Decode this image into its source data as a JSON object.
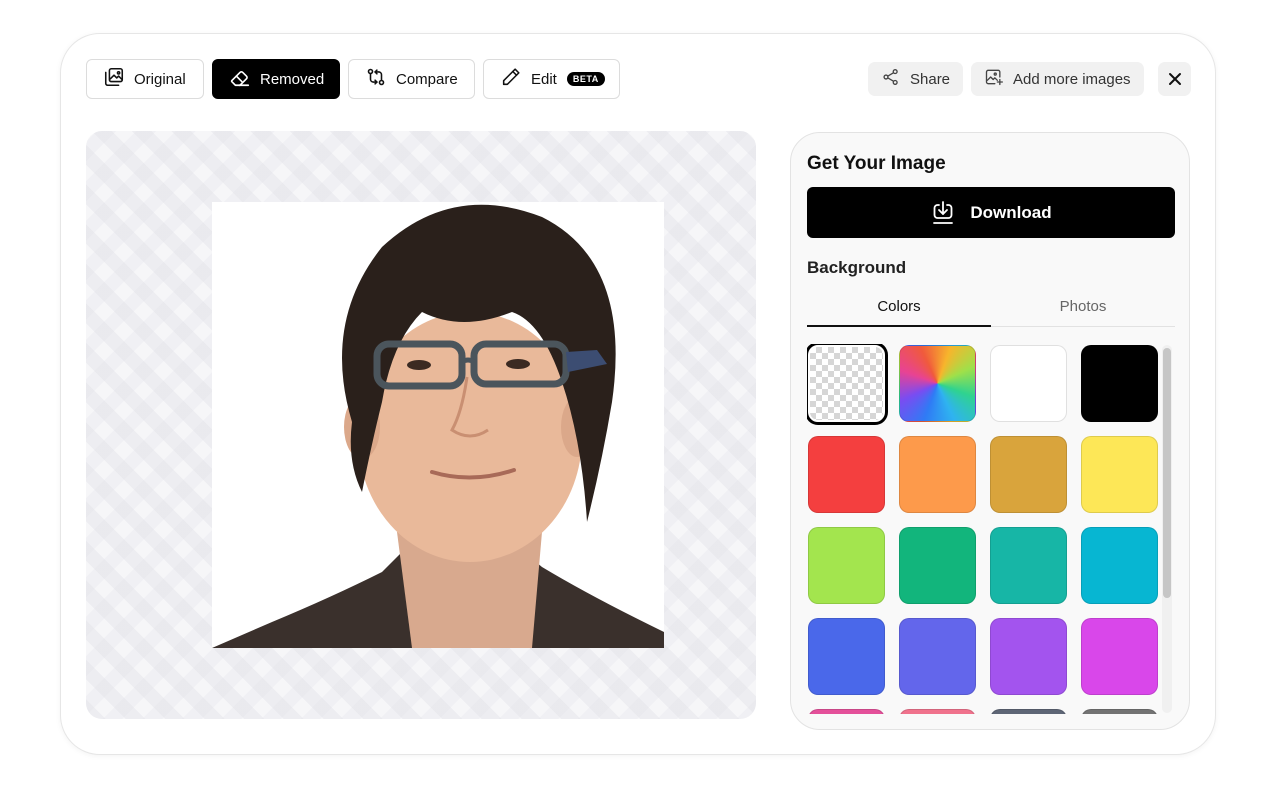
{
  "toolbar": {
    "original_label": "Original",
    "removed_label": "Removed",
    "compare_label": "Compare",
    "edit_label": "Edit",
    "edit_badge": "BETA",
    "share_label": "Share",
    "add_more_label": "Add more images"
  },
  "panel": {
    "title": "Get Your Image",
    "download_label": "Download",
    "background_title": "Background",
    "tabs": [
      {
        "label": "Colors",
        "active": true
      },
      {
        "label": "Photos",
        "active": false
      }
    ],
    "swatches": [
      {
        "name": "transparent",
        "color": "transparent",
        "selected": true
      },
      {
        "name": "rainbow",
        "color": "conic"
      },
      {
        "name": "white",
        "color": "#ffffff"
      },
      {
        "name": "black",
        "color": "#000000"
      },
      {
        "name": "red",
        "color": "#f43f3f"
      },
      {
        "name": "orange",
        "color": "#fd9a4b"
      },
      {
        "name": "gold",
        "color": "#d9a43c"
      },
      {
        "name": "yellow",
        "color": "#fde757"
      },
      {
        "name": "lime",
        "color": "#a3e54e"
      },
      {
        "name": "emerald",
        "color": "#12b57c"
      },
      {
        "name": "teal",
        "color": "#17b6a6"
      },
      {
        "name": "cyan",
        "color": "#07b6d2"
      },
      {
        "name": "blue",
        "color": "#4a68ea"
      },
      {
        "name": "indigo",
        "color": "#6366eb"
      },
      {
        "name": "purple",
        "color": "#a354ee"
      },
      {
        "name": "fuchsia",
        "color": "#d947ea"
      },
      {
        "name": "pink",
        "color": "#e4509a"
      },
      {
        "name": "rose",
        "color": "#f0728c"
      },
      {
        "name": "slate",
        "color": "#5e6676"
      },
      {
        "name": "gray",
        "color": "#737373"
      }
    ]
  }
}
